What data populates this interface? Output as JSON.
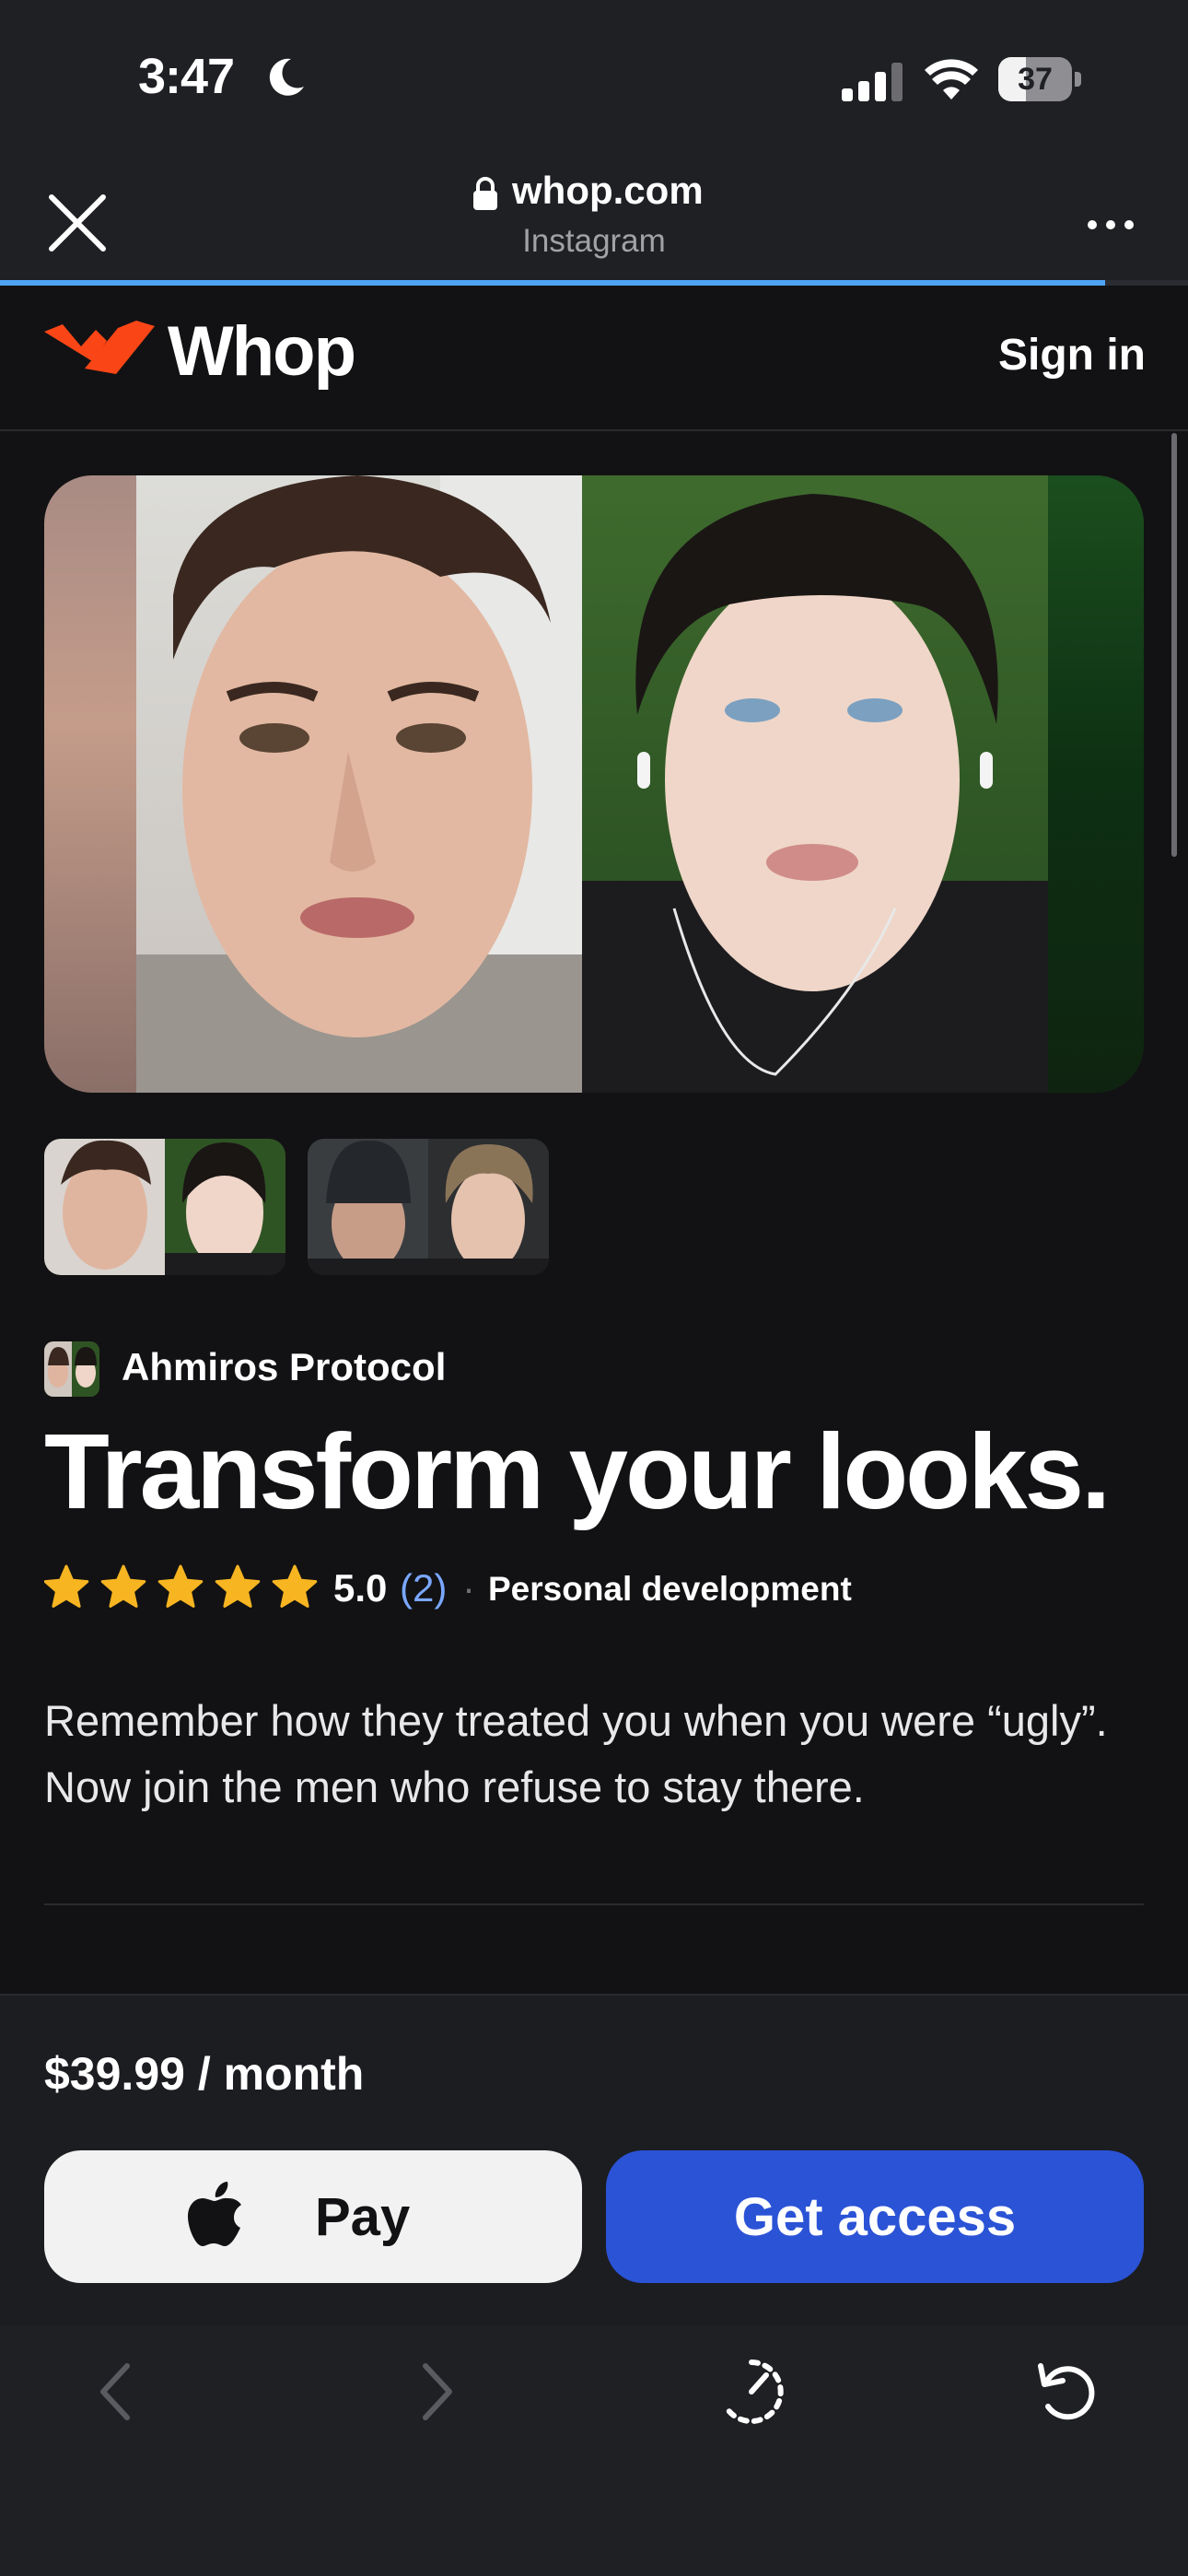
{
  "status_bar": {
    "time": "3:47",
    "battery_level": "37",
    "battery_fraction": 0.37,
    "icons": [
      "moon-icon",
      "cellular-signal-icon",
      "wifi-icon",
      "battery-icon"
    ]
  },
  "browser": {
    "domain": "whop.com",
    "source_app": "Instagram",
    "load_progress": 0.93,
    "icons": [
      "close-icon",
      "lock-icon",
      "more-icon"
    ]
  },
  "header": {
    "brand": "Whop",
    "sign_in": "Sign in",
    "logo_color": "#fa4616"
  },
  "product": {
    "creator": "Ahmiros Protocol",
    "title": "Transform your looks.",
    "rating_value": "5.0",
    "rating_count": "(2)",
    "stars": 5,
    "separator": "·",
    "category": "Personal development",
    "description": "Remember how they treated you when you were “ugly”. Now join the men who refuse to stay there."
  },
  "gallery": {
    "thumbnail_count": 2,
    "selected_index": 0
  },
  "purchase": {
    "price": "$39.99 / month",
    "apple_pay_label": "Pay",
    "get_access_label": "Get access",
    "accent_color": "#2b53d6"
  },
  "toolbar": {
    "icons": [
      "back-arrow-icon",
      "forward-arrow-icon",
      "speed-dial-icon",
      "reload-icon"
    ]
  }
}
